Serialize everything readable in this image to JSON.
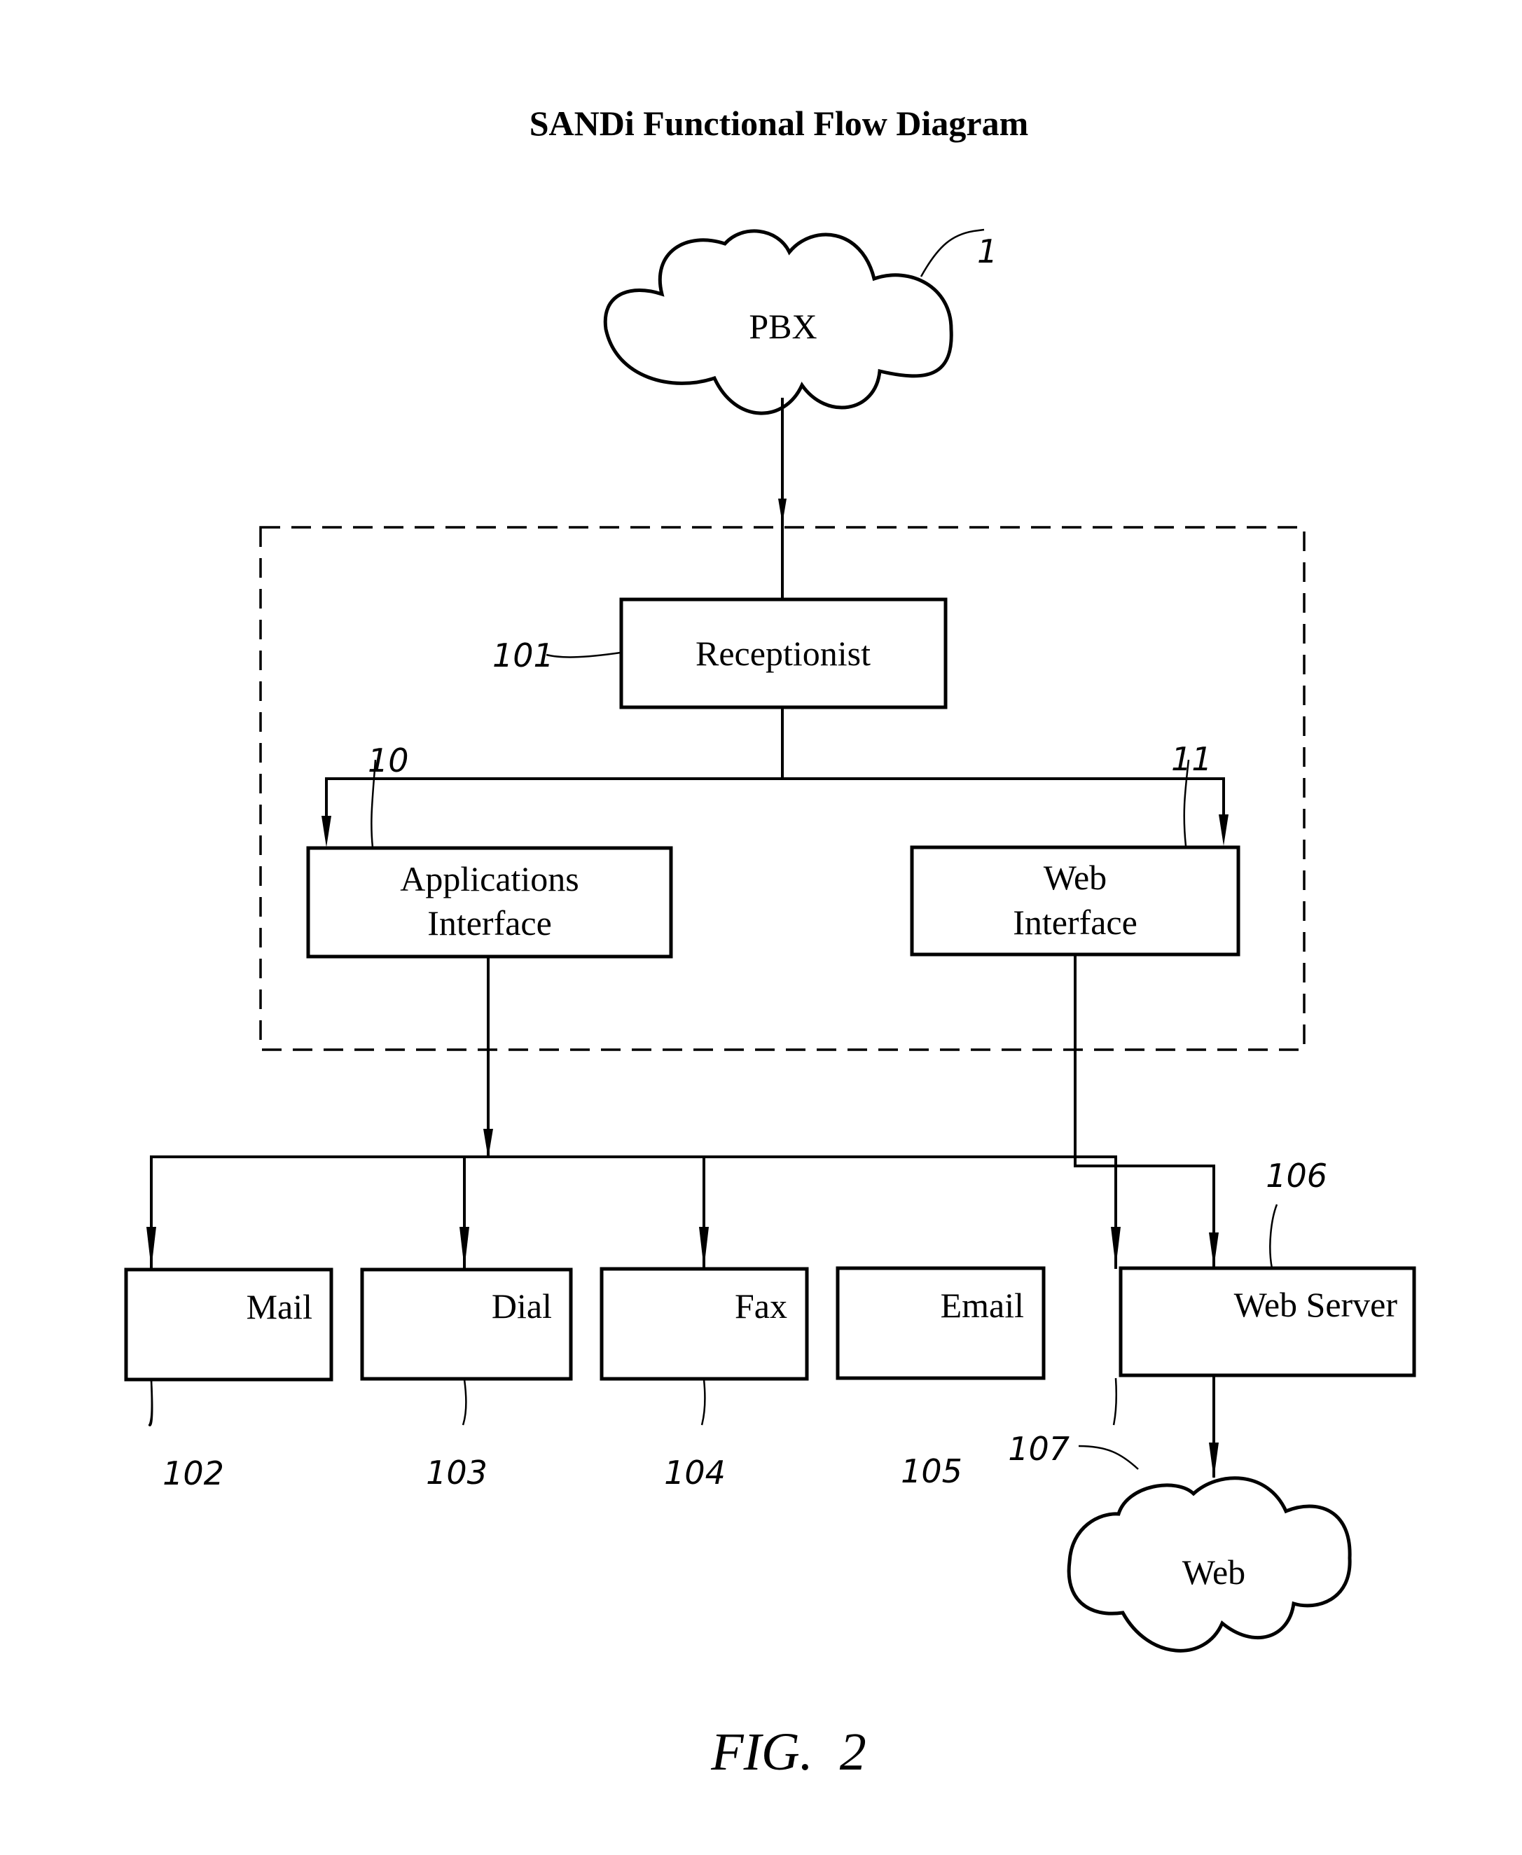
{
  "title": "SANDi Functional Flow Diagram",
  "figure_caption": "FIG.  2",
  "nodes": {
    "pbx": {
      "label": "PBX",
      "ref": "1",
      "shape": "cloud"
    },
    "receptionist": {
      "label": "Receptionist",
      "ref": "101",
      "shape": "box"
    },
    "applications_interface": {
      "label_line1": "Applications",
      "label_line2": "Interface",
      "ref": "10",
      "shape": "box"
    },
    "web_interface": {
      "label_line1": "Web",
      "label_line2": "Interface",
      "ref": "11",
      "shape": "box"
    },
    "mail": {
      "label": "Mail",
      "ref": "102",
      "shape": "box"
    },
    "dial": {
      "label": "Dial",
      "ref": "103",
      "shape": "box"
    },
    "fax": {
      "label": "Fax",
      "ref": "104",
      "shape": "box"
    },
    "email": {
      "label": "Email",
      "ref": "105",
      "shape": "box"
    },
    "web_server": {
      "label": "Web Server",
      "ref": "106",
      "shape": "box"
    },
    "web": {
      "label": "Web",
      "ref": "107",
      "shape": "cloud"
    }
  },
  "edges": [
    {
      "from": "pbx",
      "to": "receptionist"
    },
    {
      "from": "receptionist",
      "to": "applications_interface"
    },
    {
      "from": "receptionist",
      "to": "web_interface"
    },
    {
      "from": "applications_interface",
      "to": "mail"
    },
    {
      "from": "applications_interface",
      "to": "dial"
    },
    {
      "from": "applications_interface",
      "to": "fax"
    },
    {
      "from": "applications_interface",
      "to": "email"
    },
    {
      "from": "web_interface",
      "to": "web_server"
    },
    {
      "from": "web_server",
      "to": "web"
    }
  ],
  "groups": [
    {
      "name": "sandi-system-boundary",
      "members": [
        "receptionist",
        "applications_interface",
        "web_interface"
      ],
      "style": "dashed"
    }
  ]
}
